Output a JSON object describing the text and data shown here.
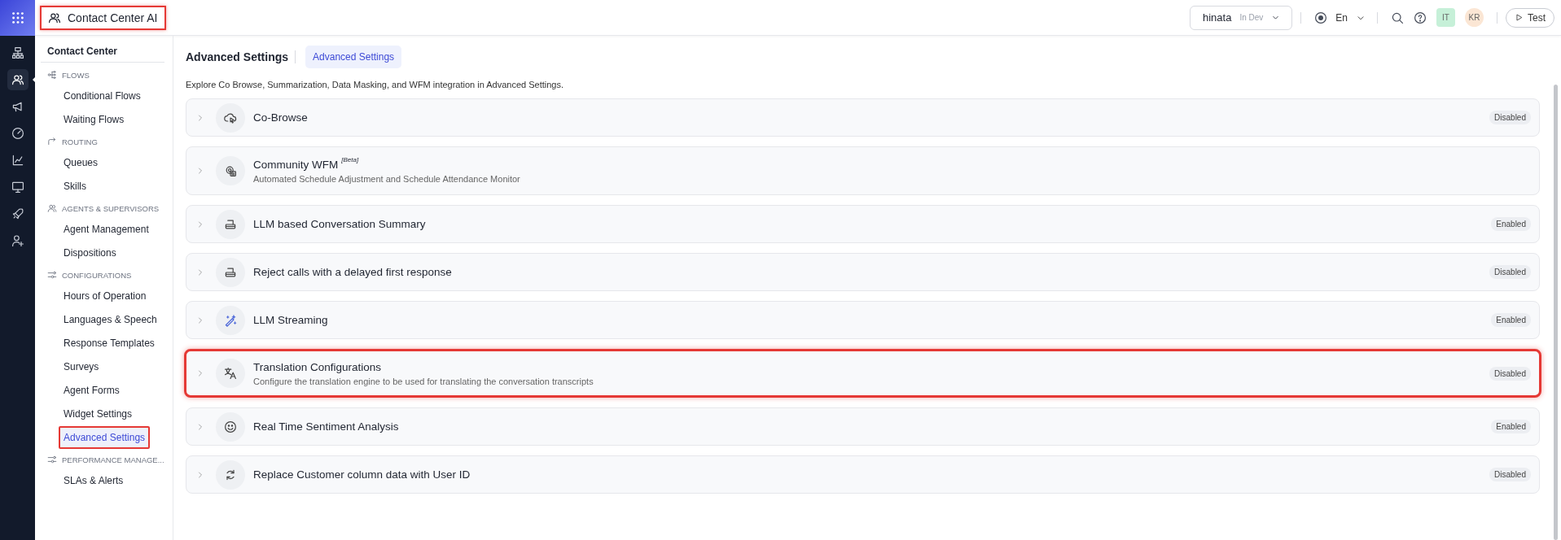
{
  "topbar": {
    "app_title": "Contact Center AI",
    "app_highlighted": true,
    "workspace": "hinata",
    "environment": "In Dev",
    "language": "En",
    "avatars": [
      {
        "initials": "IT",
        "color": "#c6f0d8"
      },
      {
        "initials": "KR",
        "color": "#fbe6d4"
      }
    ],
    "test_button": "Test"
  },
  "rail": [
    {
      "kind": "hierarchy",
      "selected": false
    },
    {
      "kind": "users",
      "selected": true
    },
    {
      "kind": "megaphone",
      "selected": false
    },
    {
      "kind": "gauge",
      "selected": false
    },
    {
      "kind": "chart",
      "selected": false
    },
    {
      "kind": "monitor",
      "selected": false
    },
    {
      "kind": "rocket",
      "selected": false
    },
    {
      "kind": "userplus",
      "selected": false
    }
  ],
  "sidebar": {
    "title": "Contact Center",
    "sections": [
      {
        "label": "FLOWS",
        "kind": "flow",
        "items": [
          {
            "label": "Conditional Flows",
            "selected": false,
            "highlighted": false
          },
          {
            "label": "Waiting Flows",
            "selected": false,
            "highlighted": false
          }
        ]
      },
      {
        "label": "ROUTING",
        "kind": "route",
        "items": [
          {
            "label": "Queues",
            "selected": false,
            "highlighted": false
          },
          {
            "label": "Skills",
            "selected": false,
            "highlighted": false
          }
        ]
      },
      {
        "label": "AGENTS & SUPERVISORS",
        "kind": "users",
        "items": [
          {
            "label": "Agent Management",
            "selected": false,
            "highlighted": false
          },
          {
            "label": "Dispositions",
            "selected": false,
            "highlighted": false
          }
        ]
      },
      {
        "label": "CONFIGURATIONS",
        "kind": "sliders",
        "items": [
          {
            "label": "Hours of Operation",
            "selected": false,
            "highlighted": false
          },
          {
            "label": "Languages & Speech",
            "selected": false,
            "highlighted": false
          },
          {
            "label": "Response Templates",
            "selected": false,
            "highlighted": false
          },
          {
            "label": "Surveys",
            "selected": false,
            "highlighted": false
          },
          {
            "label": "Agent Forms",
            "selected": false,
            "highlighted": false
          },
          {
            "label": "Widget Settings",
            "selected": false,
            "highlighted": false
          },
          {
            "label": "Advanced Settings",
            "selected": true,
            "highlighted": true
          }
        ]
      },
      {
        "label": "PERFORMANCE MANAGE...",
        "kind": "sliders",
        "items": [
          {
            "label": "SLAs & Alerts",
            "selected": false,
            "highlighted": false
          }
        ]
      }
    ]
  },
  "page": {
    "title": "Advanced Settings",
    "tabs": [
      {
        "label": "Advanced Settings",
        "selected": true
      }
    ],
    "description": "Explore Co Browse, Summarization, Data Masking, and WFM integration in Advanced Settings."
  },
  "settings": [
    {
      "kind": "cloud",
      "title": "Co-Browse",
      "status": "Disabled",
      "highlighted": false
    },
    {
      "kind": "geardoc",
      "title": "Community WFM",
      "tag": "[Beta]",
      "description": "Automated Schedule Adjustment and Schedule Attendance Monitor",
      "highlighted": false
    },
    {
      "kind": "tray",
      "title": "LLM based Conversation Summary",
      "status": "Enabled",
      "highlighted": false
    },
    {
      "kind": "tray",
      "title": "Reject calls with a delayed first response",
      "status": "Disabled",
      "highlighted": false
    },
    {
      "kind": "wand",
      "title": "LLM Streaming",
      "status": "Enabled",
      "highlighted": false
    },
    {
      "kind": "translate",
      "title": "Translation Configurations",
      "description": "Configure the translation engine to be used for translating the conversation transcripts",
      "status": "Disabled",
      "highlighted": true
    },
    {
      "kind": "smile",
      "title": "Real Time Sentiment Analysis",
      "status": "Enabled",
      "highlighted": false
    },
    {
      "kind": "refresh",
      "title": "Replace Customer column data with User ID",
      "status": "Disabled",
      "highlighted": false
    }
  ]
}
